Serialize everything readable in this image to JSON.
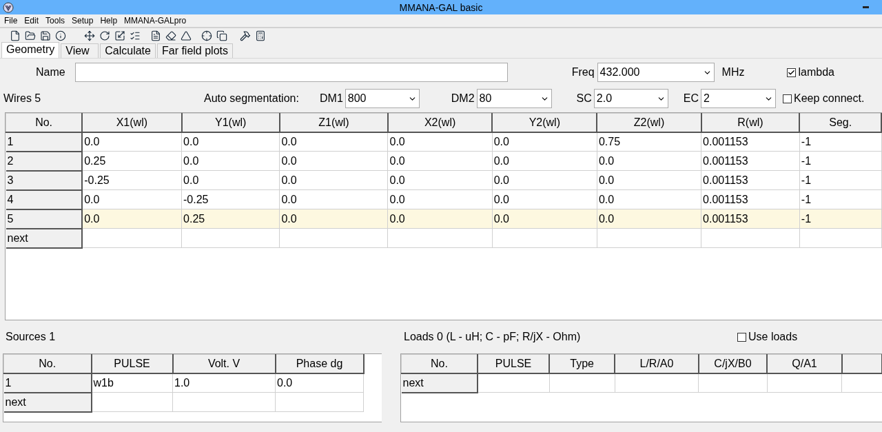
{
  "window": {
    "title": "MMANA-GAL basic"
  },
  "menu": [
    "File",
    "Edit",
    "Tools",
    "Setup",
    "Help",
    "MMANA-GALpro"
  ],
  "tabs": [
    {
      "label": "Geometry",
      "selected": true
    },
    {
      "label": "View",
      "selected": false
    },
    {
      "label": "Calculate",
      "selected": false
    },
    {
      "label": "Far field plots",
      "selected": false
    }
  ],
  "name_field": {
    "label": "Name"
  },
  "freq": {
    "label": "Freq",
    "value": "432.000",
    "unit": "MHz"
  },
  "lambda": {
    "label": "lambda",
    "checked": true
  },
  "wires_label": "Wires 5",
  "auto_segmentation": {
    "label": "Auto segmentation:",
    "fields": [
      {
        "label": "DM1",
        "value": "800"
      },
      {
        "label": "DM2",
        "value": "80"
      },
      {
        "label": "SC",
        "value": "2.0"
      },
      {
        "label": "EC",
        "value": "2"
      }
    ]
  },
  "keep_connect": {
    "label": "Keep connect.",
    "checked": false
  },
  "wires_table": {
    "columns": [
      "No.",
      "X1(wl)",
      "Y1(wl)",
      "Z1(wl)",
      "X2(wl)",
      "Y2(wl)",
      "Z2(wl)",
      "R(wl)",
      "Seg."
    ],
    "rows": [
      {
        "cells": [
          "1",
          "0.0",
          "0.0",
          "0.0",
          "0.0",
          "0.0",
          "0.75",
          "0.001153",
          "-1"
        ],
        "selected": false
      },
      {
        "cells": [
          "2",
          "0.25",
          "0.0",
          "0.0",
          "0.0",
          "0.0",
          "0.0",
          "0.001153",
          "-1"
        ],
        "selected": false
      },
      {
        "cells": [
          "3",
          "-0.25",
          "0.0",
          "0.0",
          "0.0",
          "0.0",
          "0.0",
          "0.001153",
          "-1"
        ],
        "selected": false
      },
      {
        "cells": [
          "4",
          "0.0",
          "-0.25",
          "0.0",
          "0.0",
          "0.0",
          "0.0",
          "0.001153",
          "-1"
        ],
        "selected": false
      },
      {
        "cells": [
          "5",
          "0.0",
          "0.25",
          "0.0",
          "0.0",
          "0.0",
          "0.0",
          "0.001153",
          "-1"
        ],
        "selected": true
      }
    ],
    "next_label": "next"
  },
  "sources": {
    "label": "Sources 1",
    "columns": [
      "No.",
      "PULSE",
      "Volt. V",
      "Phase dg"
    ],
    "rows": [
      {
        "cells": [
          "1",
          "w1b",
          "1.0",
          "0.0"
        ],
        "selected": false
      }
    ],
    "next_label": "next"
  },
  "loads": {
    "label": "Loads 0 (L - uH; C - pF; R/jX - Ohm)",
    "use_loads": {
      "label": "Use loads",
      "checked": false
    },
    "columns": [
      "No.",
      "PULSE",
      "Type",
      "L/R/A0",
      "C/jX/B0",
      "Q/A1"
    ],
    "next_label": "next"
  }
}
